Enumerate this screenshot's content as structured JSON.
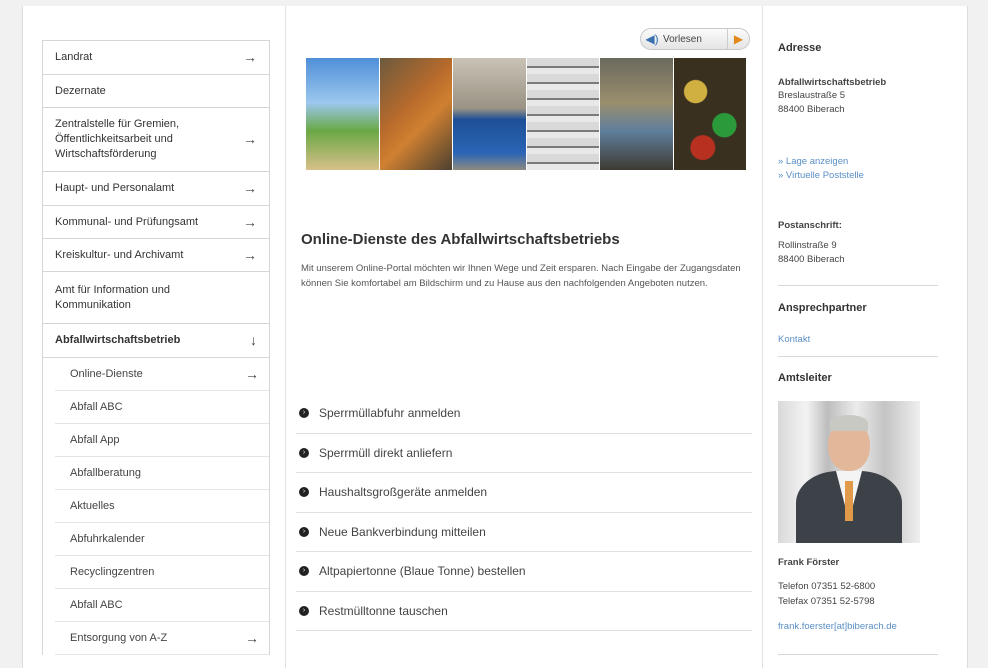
{
  "nav": {
    "items": [
      {
        "label": "Landrat",
        "arrow": "→"
      },
      {
        "label": "Dezernate",
        "arrow": ""
      },
      {
        "label": "Zentralstelle für Gremien, Öffentlichkeitsarbeit und Wirtschaftsförderung",
        "arrow": "→"
      },
      {
        "label": "Haupt- und Personalamt",
        "arrow": "→"
      },
      {
        "label": "Kommunal- und Prüfungsamt",
        "arrow": "→"
      },
      {
        "label": "Kreiskultur- und Archivamt",
        "arrow": "→"
      },
      {
        "label": "Amt für Information und Kommunikation",
        "arrow": ""
      },
      {
        "label": "Abfallwirtschaftsbetrieb",
        "arrow": "↓"
      }
    ],
    "sub_items": [
      {
        "label": "Online-Dienste",
        "arrow": "→"
      },
      {
        "label": "Abfall ABC",
        "arrow": ""
      },
      {
        "label": "Abfall App",
        "arrow": ""
      },
      {
        "label": "Abfallberatung",
        "arrow": ""
      },
      {
        "label": "Aktuelles",
        "arrow": ""
      },
      {
        "label": "Abfuhrkalender",
        "arrow": ""
      },
      {
        "label": "Recyclingzentren",
        "arrow": ""
      },
      {
        "label": "Abfall ABC",
        "arrow": ""
      },
      {
        "label": "Entsorgung von A-Z",
        "arrow": "→"
      }
    ]
  },
  "main": {
    "read_button": {
      "icon": "speaker-icon",
      "label": "Vorlesen",
      "play_icon": "▶"
    },
    "title": "Online-Dienste des Abfallwirtschaftsbetriebs",
    "intro": "Mit unserem Online-Portal möchten wir Ihnen Wege und Zeit ersparen. Nach Eingabe der Zugangsdaten können Sie komfortabel am Bildschirm und zu Hause aus den nachfolgenden Angeboten nutzen.",
    "services": [
      "Sperrmüllabfuhr anmelden",
      "Sperrmüll direkt anliefern",
      "Haushaltsgroßgeräte anmelden",
      "Neue Bankverbindung mitteilen",
      "Altpapiertonne (Blaue Tonne) bestellen",
      "Restmülltonne tauschen"
    ]
  },
  "sidebar": {
    "address_heading": "Adresse",
    "org_name": "Abfallwirtschaftsbetrieb",
    "street": "Breslaustraße 5",
    "city": "88400 Biberach",
    "link_map": "» Lage anzeigen",
    "link_virtual": "» Virtuelle Poststelle",
    "postal_heading": "Postanschrift:",
    "postal_street": "Rollinstraße 9",
    "postal_city": "88400 Biberach",
    "contact_heading": "Ansprechpartner",
    "contact_link": "Kontakt",
    "head_heading": "Amtsleiter",
    "person_name": "Frank Förster",
    "phone": "Telefon 07351 52-6800",
    "fax": "Telefax 07351 52-5798",
    "email": "frank.foerster[at]biberach.de"
  }
}
